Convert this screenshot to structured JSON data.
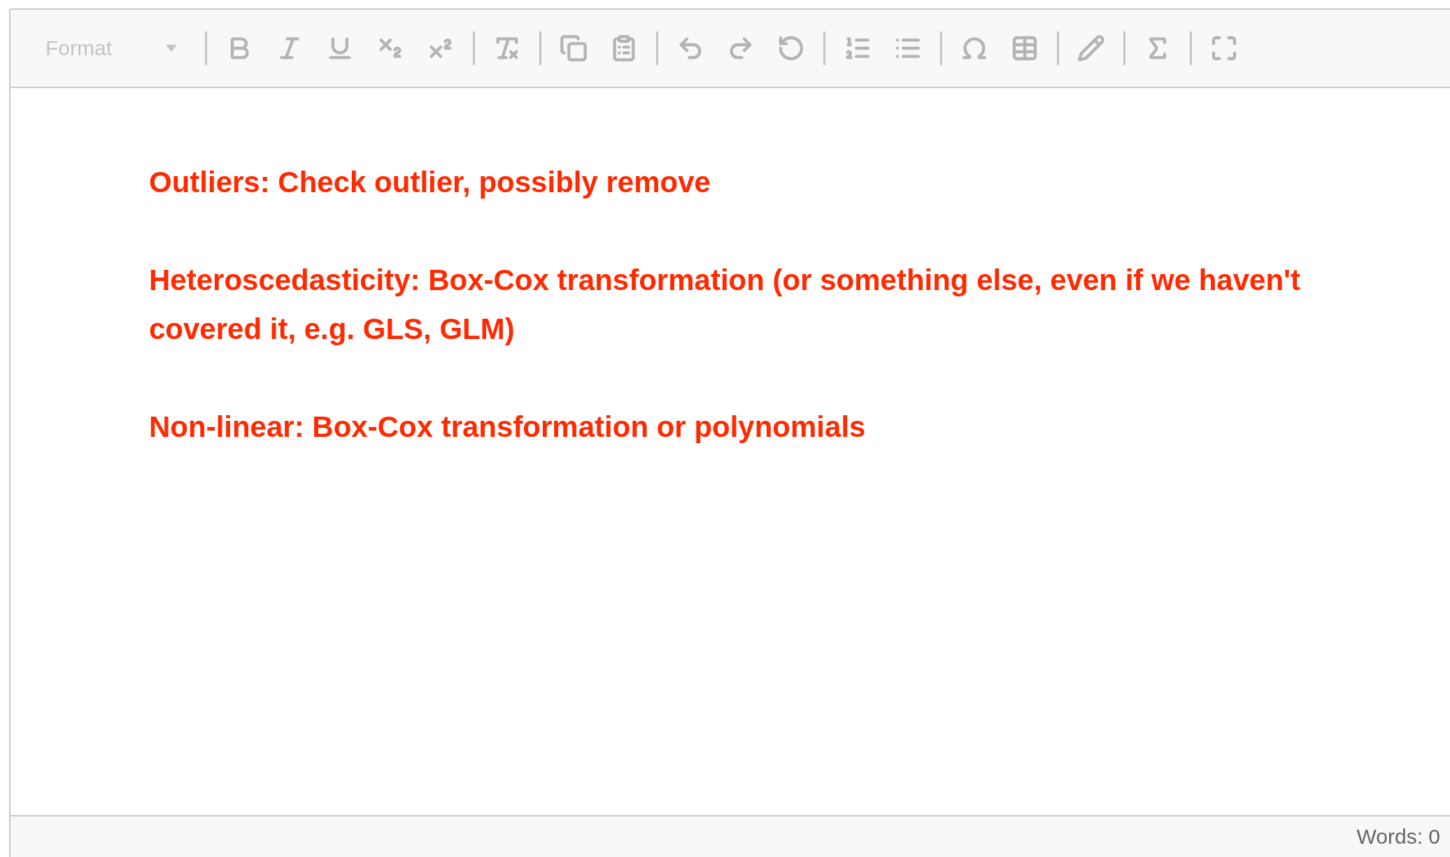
{
  "toolbar": {
    "format": {
      "label": "Format",
      "disabled": true
    },
    "groups": [
      [
        {
          "kind": "bold",
          "disabled": true
        },
        {
          "kind": "italic",
          "disabled": true
        },
        {
          "kind": "underline",
          "disabled": true
        },
        {
          "kind": "subscript",
          "disabled": true
        },
        {
          "kind": "superscript",
          "disabled": true
        }
      ],
      [
        {
          "kind": "remove-format",
          "disabled": true
        }
      ],
      [
        {
          "kind": "copy",
          "disabled": true
        },
        {
          "kind": "paste",
          "disabled": true
        }
      ],
      [
        {
          "kind": "undo",
          "disabled": true
        },
        {
          "kind": "redo",
          "disabled": true
        },
        {
          "kind": "revert",
          "disabled": true
        }
      ],
      [
        {
          "kind": "numbered-list",
          "disabled": true
        },
        {
          "kind": "bulleted-list",
          "disabled": true
        }
      ],
      [
        {
          "kind": "special-character",
          "disabled": true
        },
        {
          "kind": "table",
          "disabled": true
        }
      ],
      [
        {
          "kind": "pencil",
          "disabled": true
        }
      ],
      [
        {
          "kind": "sum",
          "disabled": true
        }
      ],
      [
        {
          "kind": "maximize",
          "disabled": true
        }
      ]
    ]
  },
  "paragraphs": [
    "Outliers: Check outlier, possibly remove",
    "Heteroscedasticity: Box-Cox transformation (or something else, even if we haven't covered it, e.g. GLS, GLM)",
    "Non-linear: Box-Cox transformation or polynomials"
  ],
  "status_bar": {
    "word_count": "Words: 0"
  }
}
